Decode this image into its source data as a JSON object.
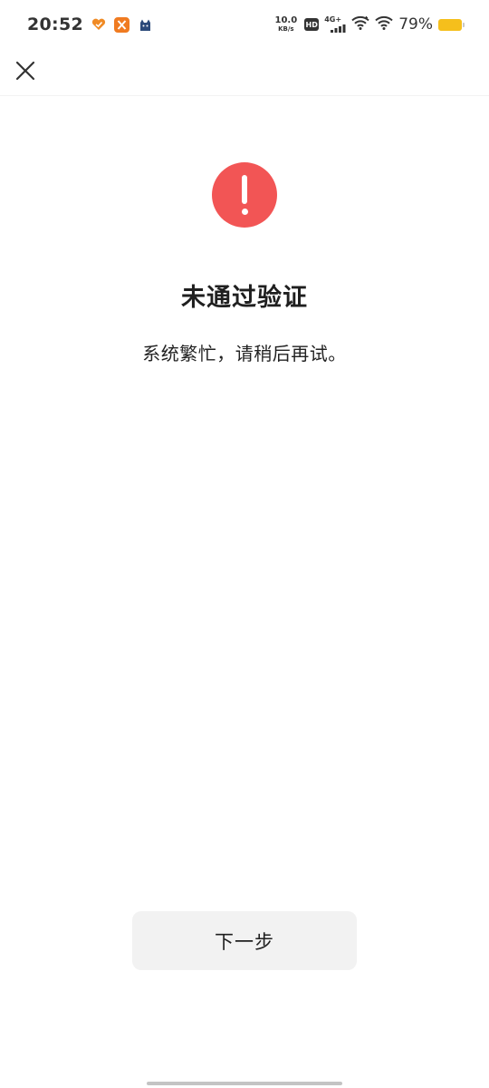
{
  "status_bar": {
    "time": "20:52",
    "net_speed": "10.0",
    "net_unit": "KB/s",
    "hd_label": "HD",
    "network_type": "4G+",
    "battery_percent": "79%",
    "battery_color": "#f5bf1c",
    "app_icons": [
      "heart-icon",
      "fork-app-icon",
      "cat-icon"
    ]
  },
  "nav": {
    "close_icon": "close-icon"
  },
  "result": {
    "icon": "exclamation-icon",
    "icon_color": "#f25555",
    "title": "未通过验证",
    "message": "系统繁忙，请稍后再试。"
  },
  "actions": {
    "next_label": "下一步"
  }
}
